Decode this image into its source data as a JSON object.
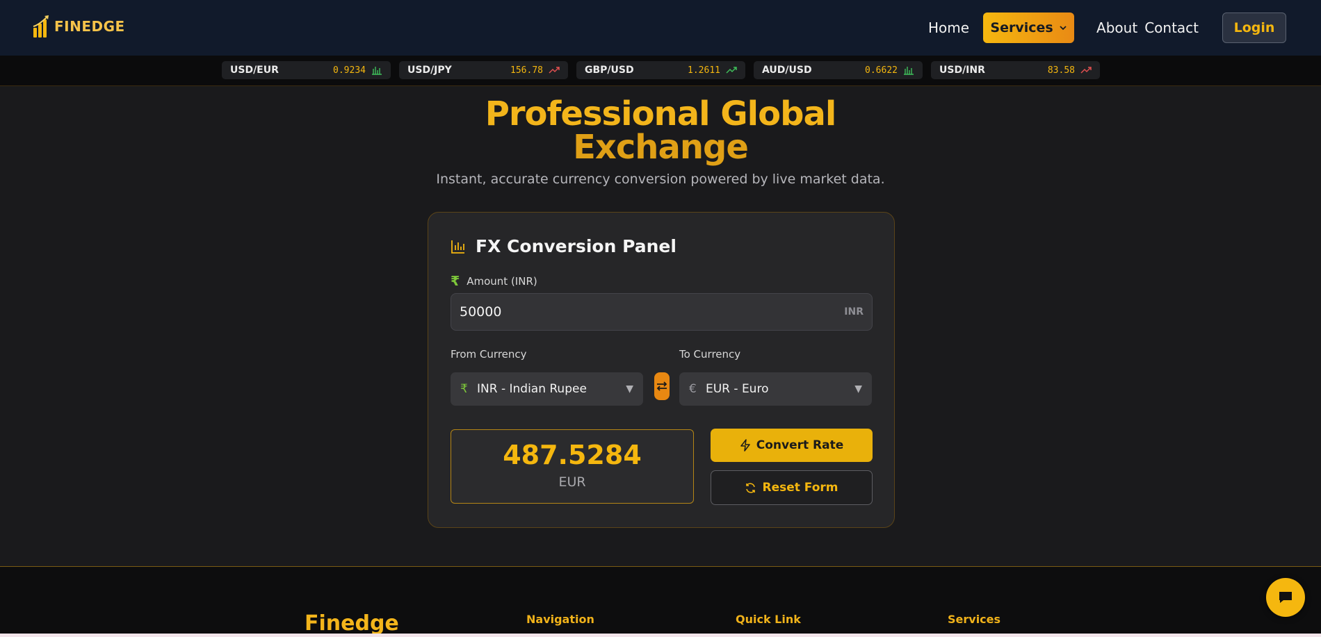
{
  "brand": {
    "name": "FINEDGE"
  },
  "nav": {
    "home": "Home",
    "services": "Services",
    "about": "About",
    "contact": "Contact",
    "login": "Login"
  },
  "ticker": [
    {
      "pair": "USD/EUR",
      "value": "0.9234",
      "trend": "bars-icon",
      "color": "#3fbf5a"
    },
    {
      "pair": "USD/JPY",
      "value": "156.78",
      "trend": "trend-up-icon",
      "color": "#e25050"
    },
    {
      "pair": "GBP/USD",
      "value": "1.2611",
      "trend": "trend-up-icon",
      "color": "#3fbf5a"
    },
    {
      "pair": "AUD/USD",
      "value": "0.6622",
      "trend": "bars-icon",
      "color": "#3fbf5a"
    },
    {
      "pair": "USD/INR",
      "value": "83.58",
      "trend": "trend-up-icon",
      "color": "#e25050"
    }
  ],
  "hero": {
    "title_line1": "Professional Global",
    "title_line2": "Exchange",
    "subtitle": "Instant, accurate currency conversion powered by live market data."
  },
  "panel": {
    "title": "FX Conversion Panel",
    "amount_label": "Amount (INR)",
    "amount_value": "50000",
    "amount_unit": "INR",
    "from_label": "From Currency",
    "from_value": "INR - Indian Rupee",
    "from_symbol": "₹",
    "to_label": "To Currency",
    "to_value": "EUR - Euro",
    "to_symbol": "€",
    "result_value": "487.5284",
    "result_currency": "EUR",
    "convert_label": "Convert Rate",
    "reset_label": "Reset Form"
  },
  "footer": {
    "brand": "Finedge",
    "col1": "Navigation",
    "col2": "Quick Link",
    "col3": "Services"
  },
  "colors": {
    "accent": "#f5b70f",
    "accent_orange": "#e88812",
    "nav_bg": "#111a2b"
  }
}
